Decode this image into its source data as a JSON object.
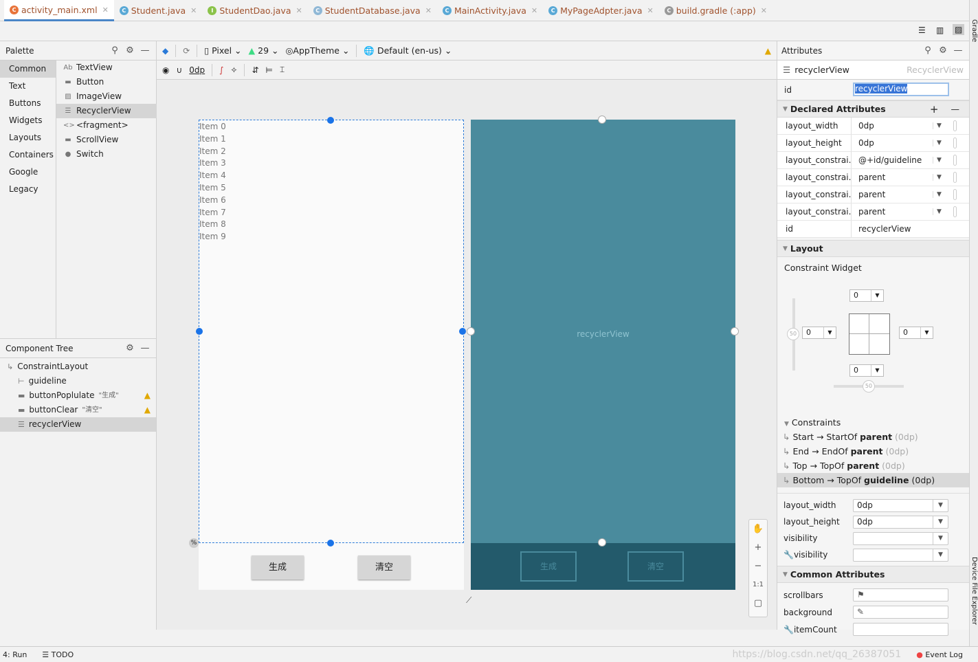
{
  "tabs": [
    {
      "label": "activity_main.xml",
      "icon": "xml-file-icon",
      "active": true
    },
    {
      "label": "Student.java",
      "icon": "class-icon"
    },
    {
      "label": "StudentDao.java",
      "icon": "interface-icon"
    },
    {
      "label": "StudentDatabase.java",
      "icon": "abstract-class-icon"
    },
    {
      "label": "MainActivity.java",
      "icon": "class-icon"
    },
    {
      "label": "MyPageAdpter.java",
      "icon": "class-icon"
    },
    {
      "label": "build.gradle (:app)",
      "icon": "gradle-icon"
    }
  ],
  "palette": {
    "title": "Palette",
    "categories": [
      "Common",
      "Text",
      "Buttons",
      "Widgets",
      "Layouts",
      "Containers",
      "Google",
      "Legacy"
    ],
    "items": [
      {
        "label": "TextView",
        "glyph": "Ab"
      },
      {
        "label": "Button",
        "glyph": "▬"
      },
      {
        "label": "ImageView",
        "glyph": "▨"
      },
      {
        "label": "RecyclerView",
        "glyph": "☰"
      },
      {
        "label": "<fragment>",
        "glyph": "<>"
      },
      {
        "label": "ScrollView",
        "glyph": "▬"
      },
      {
        "label": "Switch",
        "glyph": "●"
      }
    ]
  },
  "tree": {
    "title": "Component Tree",
    "nodes": [
      {
        "label": "ConstraintLayout",
        "extra": ""
      },
      {
        "label": "guideline",
        "extra": ""
      },
      {
        "label": "buttonPoplulate",
        "extra": "\"生成\"",
        "warn": true
      },
      {
        "label": "buttonClear",
        "extra": "\"清空\"",
        "warn": true
      },
      {
        "label": "recyclerView",
        "extra": "",
        "selected": true
      }
    ]
  },
  "toolbar": {
    "device": "Pixel",
    "api": "29",
    "theme": "AppTheme",
    "locale": "Default (en-us)",
    "margin": "0dp"
  },
  "design": {
    "items": [
      "Item 0",
      "Item 1",
      "Item 2",
      "Item 3",
      "Item 4",
      "Item 5",
      "Item 6",
      "Item 7",
      "Item 8",
      "Item 9"
    ],
    "btn1": "生成",
    "btn2": "清空",
    "blueprint_label": "recyclerView"
  },
  "zoom": {
    "fit": "1:1"
  },
  "attributes": {
    "title": "Attributes",
    "component": "recyclerView",
    "component_type": "RecyclerView",
    "id_label": "id",
    "id_value": "recyclerView",
    "declared_title": "Declared Attributes",
    "declared": [
      {
        "k": "layout_width",
        "v": "0dp"
      },
      {
        "k": "layout_height",
        "v": "0dp"
      },
      {
        "k": "layout_constrai...",
        "v": "@+id/guideline"
      },
      {
        "k": "layout_constrai...",
        "v": "parent"
      },
      {
        "k": "layout_constrai...",
        "v": "parent"
      },
      {
        "k": "layout_constrai...",
        "v": "parent"
      },
      {
        "k": "id",
        "v": "recyclerView"
      }
    ],
    "layout_title": "Layout",
    "widget_title": "Constraint Widget",
    "margins": {
      "top": "0",
      "left": "0",
      "right": "0",
      "bottom": "0",
      "bias_v": "50",
      "bias_h": "50"
    },
    "constraints_title": "Constraints",
    "constraints": [
      {
        "a": "Start → StartOf ",
        "b": "parent",
        "c": " (0dp)"
      },
      {
        "a": "End → EndOf ",
        "b": "parent",
        "c": " (0dp)"
      },
      {
        "a": "Top → TopOf ",
        "b": "parent",
        "c": " (0dp)"
      },
      {
        "a": "Bottom → TopOf ",
        "b": "guideline",
        "c": " (0dp)"
      }
    ],
    "fields": [
      {
        "k": "layout_width",
        "v": "0dp"
      },
      {
        "k": "layout_height",
        "v": "0dp"
      },
      {
        "k": "visibility",
        "v": ""
      },
      {
        "k": "visibility",
        "v": "",
        "tool": true
      }
    ],
    "common_title": "Common Attributes",
    "common": [
      {
        "k": "scrollbars",
        "icon": "flag-icon"
      },
      {
        "k": "background",
        "icon": "eyedropper-icon"
      },
      {
        "k": "itemCount",
        "tool": true
      }
    ]
  },
  "side": {
    "top": "Gradle",
    "bottom": "Device File Explorer"
  },
  "status": {
    "run": "4: Run",
    "todo": "TODO",
    "eventlog": "Event Log",
    "watermark": "https://blog.csdn.net/qq_26387051"
  }
}
